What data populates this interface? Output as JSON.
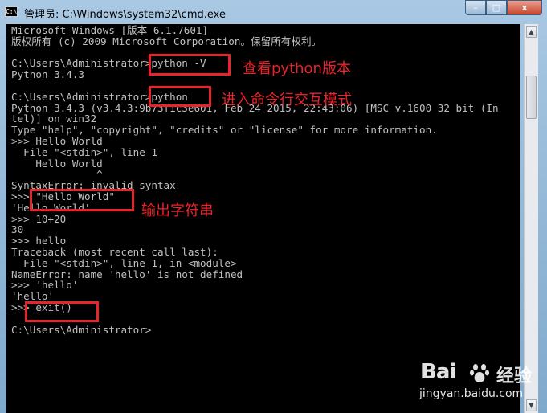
{
  "window": {
    "title": "管理员: C:\\Windows\\system32\\cmd.exe",
    "icon_text": "C:\\",
    "buttons": {
      "minimize": "–",
      "maximize": "□",
      "close": "x"
    }
  },
  "console": {
    "lines": [
      "Microsoft Windows [版本 6.1.7601]",
      "版权所有 (c) 2009 Microsoft Corporation。保留所有权利。",
      "",
      "C:\\Users\\Administrator>python -V",
      "Python 3.4.3",
      "",
      "C:\\Users\\Administrator>python",
      "Python 3.4.3 (v3.4.3:9b73f1c3e601, Feb 24 2015, 22:43:06) [MSC v.1600 32 bit (In",
      "tel)] on win32",
      "Type \"help\", \"copyright\", \"credits\" or \"license\" for more information.",
      ">>> Hello World",
      "  File \"<stdin>\", line 1",
      "    Hello World",
      "              ^",
      "SyntaxError: invalid syntax",
      ">>> \"Hello World\"",
      "'Hello World'",
      ">>> 10+20",
      "30",
      ">>> hello",
      "Traceback (most recent call last):",
      "  File \"<stdin>\", line 1, in <module>",
      "NameError: name 'hello' is not defined",
      ">>> 'hello'",
      "'hello'",
      ">>> exit()",
      "",
      "C:\\Users\\Administrator>"
    ]
  },
  "annotations": {
    "version_note": "查看python版本",
    "interactive_note": "进入命令行交互模式",
    "string_note": "输出字符串"
  },
  "watermark": {
    "logo": "Bai",
    "logo_tail": "经验",
    "url": "jingyan.baidu.com"
  },
  "colors": {
    "console_bg": "#000000",
    "console_text": "#c0c0c0",
    "annotation_red": "#e8232a"
  }
}
